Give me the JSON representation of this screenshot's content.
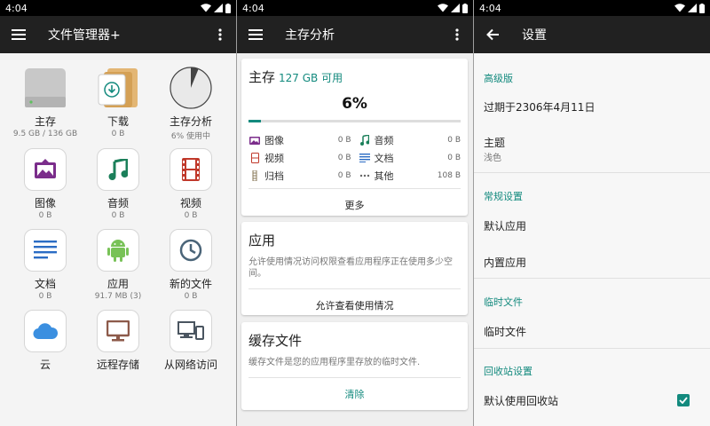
{
  "status": {
    "time": "4:04"
  },
  "colors": {
    "accent": "#138a7e",
    "appbar": "#212121",
    "image_purple": "#7b2d8b",
    "video_red": "#c0392b",
    "audio_green": "#1b7f5a",
    "doc_blue": "#2b6cc4",
    "android_green": "#78c257",
    "cloud_blue": "#3b8fe0",
    "remote_brown": "#8d5a4a"
  },
  "files_pane": {
    "title": "文件管理器+",
    "items": [
      {
        "icon": "hard-drive-icon",
        "label": "主存",
        "sub": "9.5 GB / 136 GB"
      },
      {
        "icon": "download-folder-icon",
        "label": "下载",
        "sub": "0 B"
      },
      {
        "icon": "pie-chart-icon",
        "label": "主存分析",
        "sub": "6% 使用中"
      },
      {
        "icon": "image-icon",
        "label": "图像",
        "sub": "0 B"
      },
      {
        "icon": "music-note-icon",
        "label": "音频",
        "sub": "0 B"
      },
      {
        "icon": "film-icon",
        "label": "视频",
        "sub": "0 B"
      },
      {
        "icon": "document-icon",
        "label": "文档",
        "sub": "0 B"
      },
      {
        "icon": "android-icon",
        "label": "应用",
        "sub": "91.7 MB (3)"
      },
      {
        "icon": "clock-icon",
        "label": "新的文件",
        "sub": "0 B"
      },
      {
        "icon": "cloud-icon",
        "label": "云",
        "sub": ""
      },
      {
        "icon": "monitor-icon",
        "label": "远程存储",
        "sub": ""
      },
      {
        "icon": "devices-icon",
        "label": "从网络访问",
        "sub": ""
      }
    ]
  },
  "analysis_pane": {
    "title": "主存分析",
    "storage_card": {
      "heading": "主存",
      "available": "127 GB 可用",
      "percent_label": "6%",
      "used_fraction": 0.06,
      "types": [
        {
          "icon": "image-icon",
          "name": "图像",
          "size": "0 B"
        },
        {
          "icon": "music-note-icon",
          "name": "音频",
          "size": "0 B"
        },
        {
          "icon": "video-icon",
          "name": "视频",
          "size": "0 B"
        },
        {
          "icon": "document-icon",
          "name": "文档",
          "size": "0 B"
        },
        {
          "icon": "archive-icon",
          "name": "归档",
          "size": "0 B"
        },
        {
          "icon": "other-icon",
          "name": "其他",
          "size": "108 B"
        }
      ],
      "more_label": "更多"
    },
    "apps_card": {
      "heading": "应用",
      "desc": "允许使用情况访问权限查看应用程序正在使用多少空间。",
      "button": "允许查看使用情况"
    },
    "cache_card": {
      "heading": "缓存文件",
      "desc": "缓存文件是您的应用程序里存放的临时文件.",
      "button": "清除"
    }
  },
  "settings_pane": {
    "title": "设置",
    "advanced_header": "高级版",
    "expiry": "过期于2306年4月11日",
    "theme_label": "主题",
    "theme_value": "浅色",
    "general_header": "常规设置",
    "default_apps": "默认应用",
    "builtin_apps": "内置应用",
    "temp_header": "临时文件",
    "temp_item": "临时文件",
    "recycle_header": "回收站设置",
    "recycle_default": "默认使用回收站",
    "recycle_checked": true
  }
}
